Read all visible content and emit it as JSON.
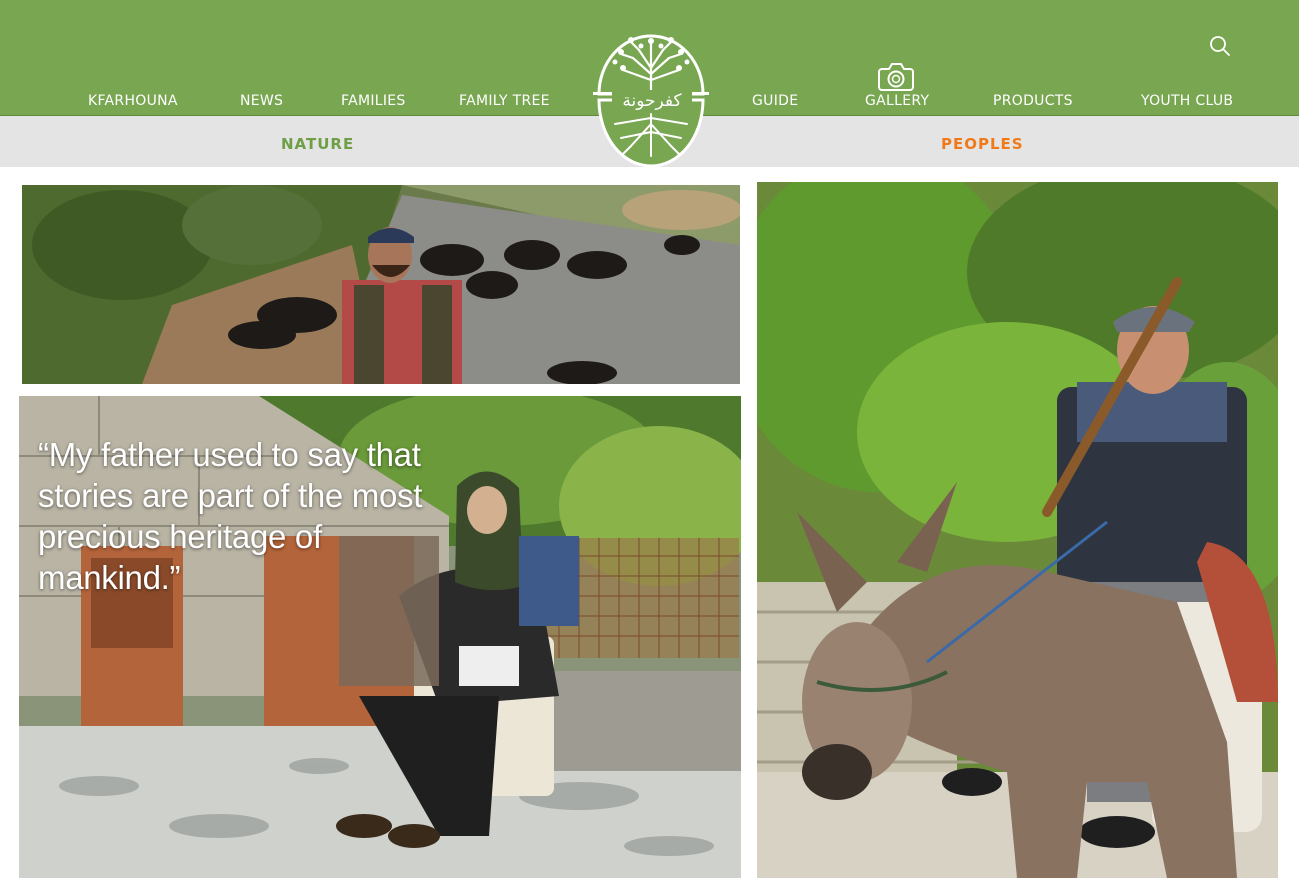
{
  "nav": {
    "items": [
      {
        "label": "KFARHOUNA"
      },
      {
        "label": "NEWS"
      },
      {
        "label": "FAMILIES"
      },
      {
        "label": "FAMILY TREE"
      },
      {
        "label": "GUIDE"
      },
      {
        "label": "GALLERY"
      },
      {
        "label": "PRODUCTS"
      },
      {
        "label": "YOUTH CLUB"
      }
    ],
    "search_icon": "search-icon",
    "gallery_icon": "camera-icon"
  },
  "logo": {
    "arabic_name": "كفرحونة",
    "icon": "tree-with-roots-logo"
  },
  "tabs": [
    {
      "label": "NATURE",
      "color": "#6e9e45"
    },
    {
      "label": "PEOPLES",
      "color": "#f07a1a"
    }
  ],
  "quote": {
    "text": "“My father used to say that stories are part of the most precious heritage of mankind.”"
  },
  "colors": {
    "brand_green": "#78a651",
    "subbar_gray": "#e4e4e4",
    "active_tab": "#f07a1a"
  }
}
